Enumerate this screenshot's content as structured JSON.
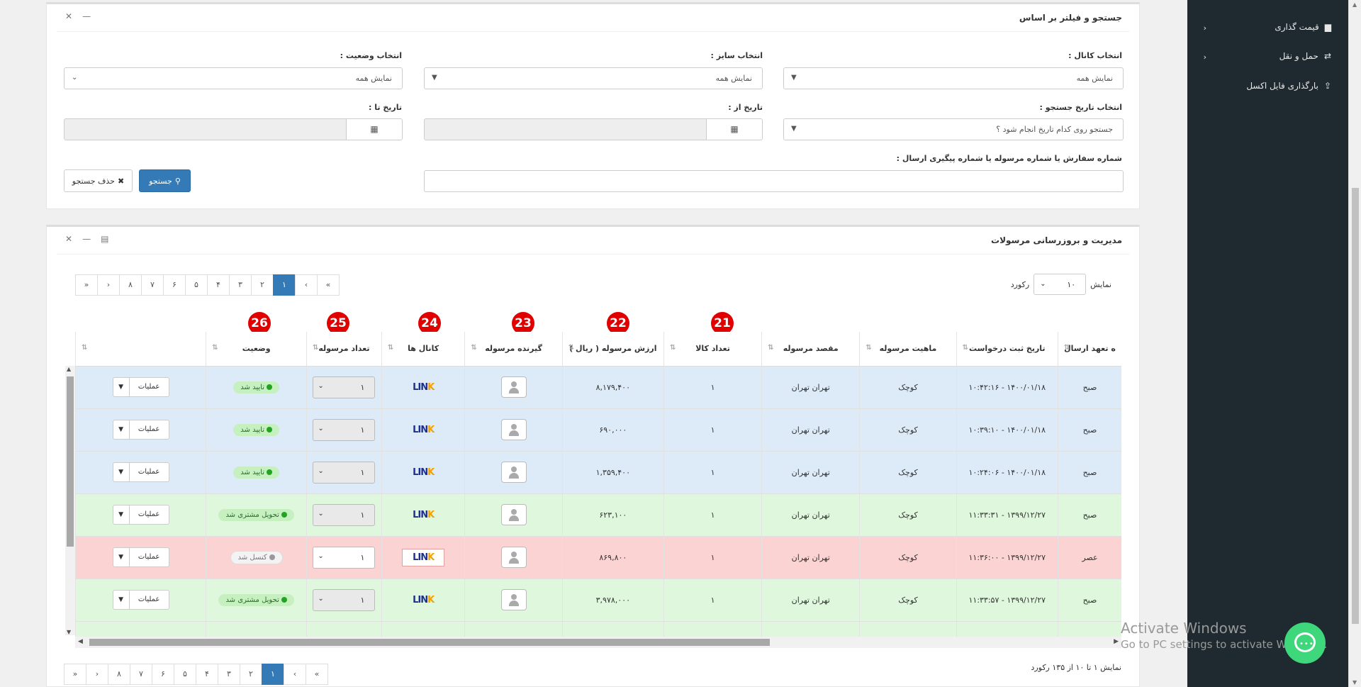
{
  "sidebar": {
    "items": [
      {
        "label": "قیمت گذاری",
        "icon": "chart-icon"
      },
      {
        "label": "حمل و نقل",
        "icon": "exchange-icon"
      },
      {
        "label": "بارگذاری فایل اکسل",
        "icon": "upload-icon"
      }
    ]
  },
  "filter_panel": {
    "title": "جستجو و فیلتر بر اساس",
    "channel_label": "انتخاب کانال :",
    "channel_value": "نمایش همه",
    "size_label": "انتخاب سایز :",
    "size_value": "نمایش همه",
    "status_label": "انتخاب وضعیت :",
    "status_value": "نمایش همه",
    "search_date_label": "انتخاب تاریخ جستجو :",
    "search_date_value": "جستجو روی کدام تاریخ انجام شود ؟",
    "date_from_label": "تاریخ از :",
    "date_to_label": "تاریخ تا :",
    "order_label": "شماره سفارش یا شماره مرسوله یا شماره پیگیری ارسال :",
    "search_button": "جستجو",
    "clear_button": "حذف جستجو"
  },
  "table_panel": {
    "title": "مدیریت و بروزرسانی مرسولات",
    "show_label": "نمایش",
    "length_value": "۱۰",
    "record_label": "رکورد",
    "pages": [
      "«",
      "‹",
      "۱",
      "۲",
      "۳",
      "۴",
      "۵",
      "۶",
      "۷",
      "۸",
      "›",
      "»"
    ],
    "active_page": "۱",
    "footer_info": "نمایش ۱ تا ۱۰ از ۱۳۵ رکورد"
  },
  "markers": [
    "21",
    "22",
    "23",
    "24",
    "25",
    "26"
  ],
  "columns": [
    "ه تعهد ارسال",
    "تاریخ ثبت درخواست",
    "ماهیت مرسوله",
    "مقصد مرسوله",
    "تعداد کالا",
    "ارزش مرسوله ( ریال )",
    "گیرنده مرسوله",
    "کانال ها",
    "تعداد مرسوله",
    "وضعیت",
    ""
  ],
  "rows": [
    {
      "shift": "صبح",
      "date": "۱۴۰۰/۰۱/۱۸ - ۱۰:۴۲:۱۶",
      "type": "کوچک",
      "dest": "تهران تهران",
      "count": "۱",
      "value": "۸,۱۷۹,۴۰۰",
      "qty": "۱",
      "status": "تایید شد",
      "ops": "عملیات"
    },
    {
      "shift": "صبح",
      "date": "۱۴۰۰/۰۱/۱۸ - ۱۰:۳۹:۱۰",
      "type": "کوچک",
      "dest": "تهران تهران",
      "count": "۱",
      "value": "۶۹۰,۰۰۰",
      "qty": "۱",
      "status": "تایید شد",
      "ops": "عملیات"
    },
    {
      "shift": "صبح",
      "date": "۱۴۰۰/۰۱/۱۸ - ۱۰:۲۴:۰۶",
      "type": "کوچک",
      "dest": "تهران تهران",
      "count": "۱",
      "value": "۱,۳۵۹,۴۰۰",
      "qty": "۱",
      "status": "تایید شد",
      "ops": "عملیات"
    },
    {
      "shift": "صبح",
      "date": "۱۳۹۹/۱۲/۲۷ - ۱۱:۳۳:۳۱",
      "type": "کوچک",
      "dest": "تهران تهران",
      "count": "۱",
      "value": "۶۲۳,۱۰۰",
      "qty": "۱",
      "status": "تحویل مشتری شد",
      "ops": "عملیات"
    },
    {
      "shift": "عصر",
      "date": "۱۳۹۹/۱۲/۲۷ - ۱۱:۳۶:۰۰",
      "type": "کوچک",
      "dest": "تهران تهران",
      "count": "۱",
      "value": "۸۶۹,۸۰۰",
      "qty": "۱",
      "status": "کنسل شد",
      "ops": "عملیات"
    },
    {
      "shift": "صبح",
      "date": "۱۳۹۹/۱۲/۲۷ - ۱۱:۳۳:۵۷",
      "type": "کوچک",
      "dest": "تهران تهران",
      "count": "۱",
      "value": "۳,۹۷۸,۰۰۰",
      "qty": "۱",
      "status": "تحویل مشتری شد",
      "ops": "عملیات"
    }
  ],
  "logo_text": "LINK",
  "watermark": {
    "line1": "Activate Windows",
    "line2": "Go to PC settings to activate Windows."
  }
}
